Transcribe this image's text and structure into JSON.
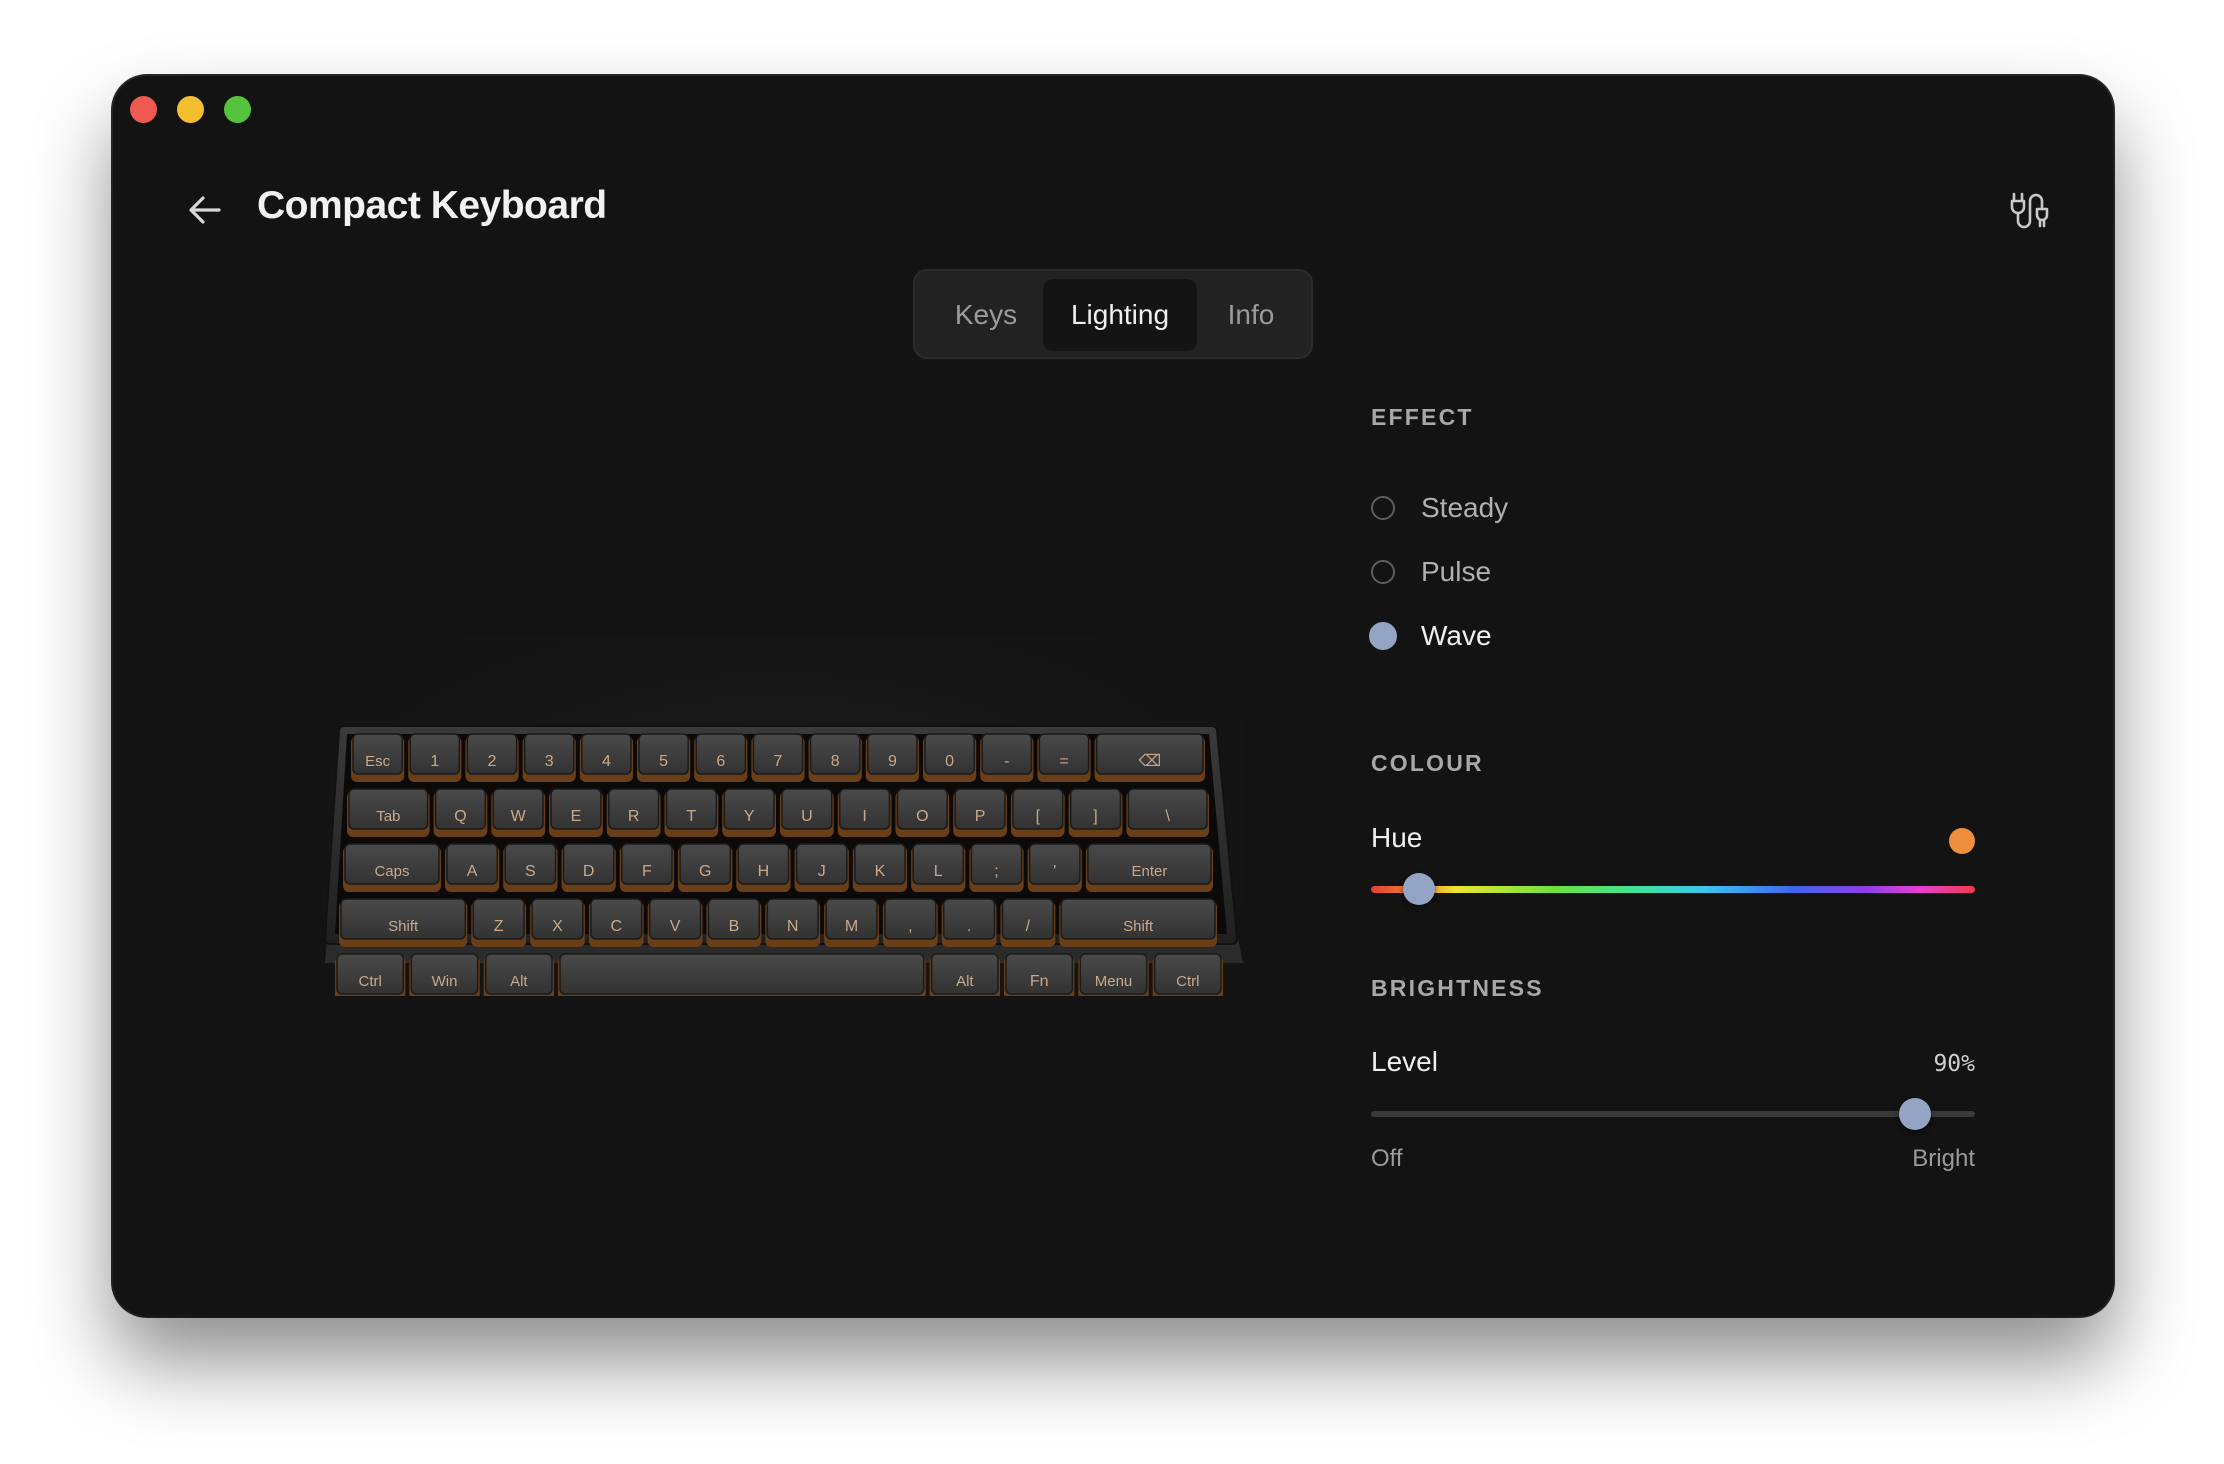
{
  "window": {
    "title": "Compact Keyboard",
    "traffic_lights": [
      "close",
      "minimize",
      "zoom"
    ]
  },
  "header": {
    "back_icon": "arrow-left-icon",
    "settings_icon": "cable-plug-icon"
  },
  "tabs": [
    {
      "label": "Keys",
      "selected": false
    },
    {
      "label": "Lighting",
      "selected": true
    },
    {
      "label": "Info",
      "selected": false
    }
  ],
  "keyboard": {
    "rows": [
      [
        "Esc",
        "1",
        "2",
        "3",
        "4",
        "5",
        "6",
        "7",
        "8",
        "9",
        "0",
        "-",
        "=",
        "⌫"
      ],
      [
        "Tab",
        "Q",
        "W",
        "E",
        "R",
        "T",
        "Y",
        "U",
        "I",
        "O",
        "P",
        "[",
        "]",
        "\\"
      ],
      [
        "Caps",
        "A",
        "S",
        "D",
        "F",
        "G",
        "H",
        "J",
        "K",
        "L",
        ";",
        "'",
        "Enter"
      ],
      [
        "Shift",
        "Z",
        "X",
        "C",
        "V",
        "B",
        "N",
        "M",
        ",",
        ".",
        "/",
        "Shift"
      ],
      [
        "Ctrl",
        "Win",
        "Alt",
        "",
        "Alt",
        "Fn",
        "Menu",
        "Ctrl"
      ]
    ]
  },
  "effect": {
    "label": "EFFECT",
    "options": [
      {
        "label": "Steady",
        "selected": false
      },
      {
        "label": "Pulse",
        "selected": false
      },
      {
        "label": "Wave",
        "selected": true
      }
    ]
  },
  "colour": {
    "label": "COLOUR",
    "hue_label": "Hue",
    "hue_value": 0.08,
    "swatch_color": "#ef8f3c"
  },
  "brightness": {
    "label": "BRIGHTNESS",
    "level_label": "Level",
    "level_text": "90%",
    "level_value": 0.9,
    "min_label": "Off",
    "max_label": "Bright"
  }
}
